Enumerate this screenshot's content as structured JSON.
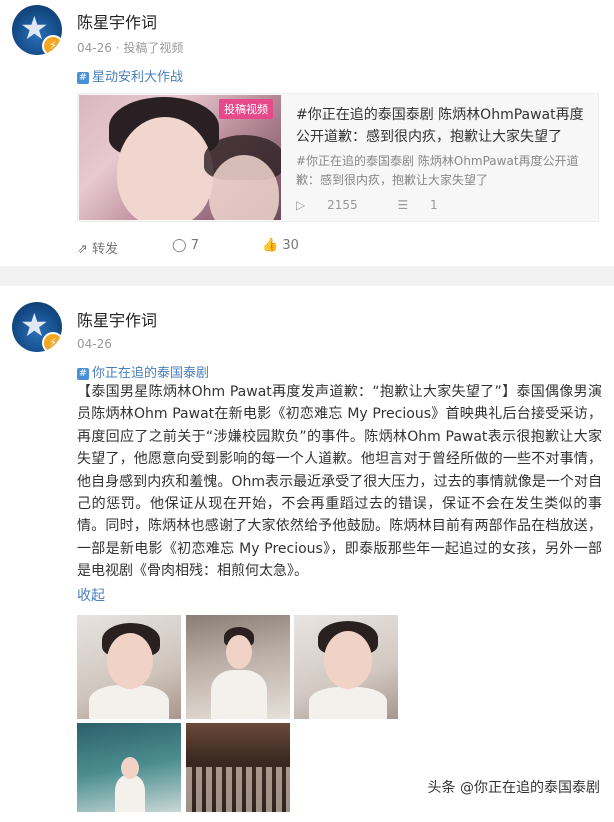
{
  "post1": {
    "username": "陈星宇作词",
    "meta": "04-26 · 投稿了视频",
    "topic": "星动安利大作战",
    "repost": {
      "tag": "投稿视频",
      "title": "#你正在追的泰国泰剧 陈炳林OhmPawat再度公开道歉：感到很内疚，抱歉让大家失望了",
      "subtitle": "#你正在追的泰国泰剧 陈炳林OhmPawat再度公开道歉：感到很内疚，抱歉让大家失望了",
      "plays": "2155",
      "comments": "1"
    },
    "actions": {
      "share": "转发",
      "comment": "7",
      "like": "30"
    }
  },
  "post2": {
    "username": "陈星宇作词",
    "meta": "04-26",
    "topic": "你正在追的泰国泰剧",
    "body": "【泰国男星陈炳林Ohm Pawat再度发声道歉：“抱歉让大家失望了”】泰国偶像男演员陈炳林Ohm Pawat在新电影《初恋难忘 My Precious》首映典礼后台接受采访，再度回应了之前关于“涉嫌校园欺负”的事件。陈炳林Ohm Pawat表示很抱歉让大家失望了，他愿意向受到影响的每一个人道歉。他坦言对于曾经所做的一些不对事情，他自身感到内疚和羞愧。Ohm表示最近承受了很大压力，过去的事情就像是一个对自己的惩罚。他保证从现在开始，不会再重蹈过去的错误，保证不会在发生类似的事情。同时，陈炳林也感谢了大家依然给予他鼓励。陈炳林目前有两部作品在档放送，一部是新电影《初恋难忘 My Precious》，即泰版那些年一起追过的女孩，另外一部是电视剧《骨肉相残：相煎何太急》。",
    "collapse": "收起"
  },
  "watermark": "头条 @你正在追的泰国泰剧"
}
